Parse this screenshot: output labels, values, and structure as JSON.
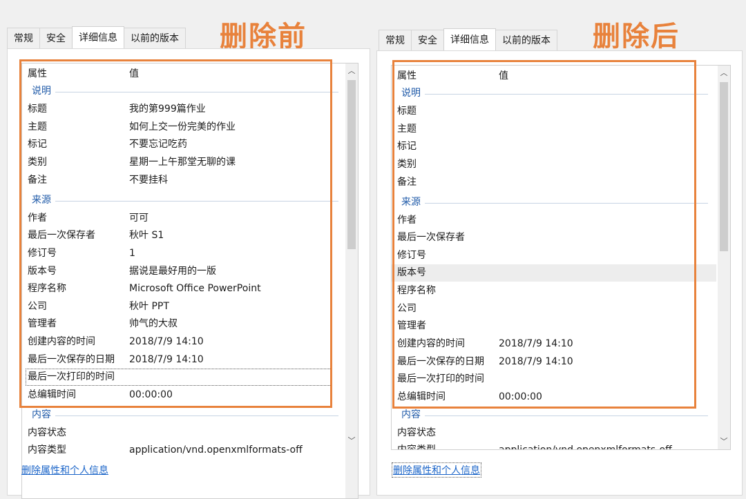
{
  "left": {
    "title": "删除前",
    "tabs": [
      "常规",
      "安全",
      "详细信息",
      "以前的版本"
    ],
    "columns": {
      "property": "属性",
      "value": "值"
    },
    "sections": {
      "desc": "说明",
      "origin": "来源",
      "content": "内容"
    },
    "rows": [
      {
        "k": "标题",
        "v": "我的第999篇作业"
      },
      {
        "k": "主题",
        "v": "如何上交一份完美的作业"
      },
      {
        "k": "标记",
        "v": "不要忘记吃药"
      },
      {
        "k": "类别",
        "v": "星期一上午那堂无聊的课"
      },
      {
        "k": "备注",
        "v": "不要挂科"
      },
      {
        "k": "作者",
        "v": "可可"
      },
      {
        "k": "最后一次保存者",
        "v": "秋叶 S1"
      },
      {
        "k": "修订号",
        "v": "1"
      },
      {
        "k": "版本号",
        "v": "据说是最好用的一版"
      },
      {
        "k": "程序名称",
        "v": "Microsoft Office PowerPoint"
      },
      {
        "k": "公司",
        "v": "秋叶 PPT"
      },
      {
        "k": "管理者",
        "v": "帅气的大叔"
      },
      {
        "k": "创建内容的时间",
        "v": "2018/7/9 14:10"
      },
      {
        "k": "最后一次保存的日期",
        "v": "2018/7/9 14:10"
      },
      {
        "k": "最后一次打印的时间",
        "v": ""
      },
      {
        "k": "总编辑时间",
        "v": "00:00:00"
      },
      {
        "k": "内容状态",
        "v": ""
      },
      {
        "k": "内容类型",
        "v": "application/vnd.openxmlformats-off"
      }
    ],
    "link": "删除属性和个人信息"
  },
  "right": {
    "title": "删除后",
    "tabs": [
      "常规",
      "安全",
      "详细信息",
      "以前的版本"
    ],
    "columns": {
      "property": "属性",
      "value": "值"
    },
    "sections": {
      "desc": "说明",
      "origin": "来源",
      "content": "内容"
    },
    "rows": [
      {
        "k": "标题",
        "v": ""
      },
      {
        "k": "主题",
        "v": ""
      },
      {
        "k": "标记",
        "v": ""
      },
      {
        "k": "类别",
        "v": ""
      },
      {
        "k": "备注",
        "v": ""
      },
      {
        "k": "作者",
        "v": ""
      },
      {
        "k": "最后一次保存者",
        "v": ""
      },
      {
        "k": "修订号",
        "v": ""
      },
      {
        "k": "版本号",
        "v": ""
      },
      {
        "k": "程序名称",
        "v": ""
      },
      {
        "k": "公司",
        "v": ""
      },
      {
        "k": "管理者",
        "v": ""
      },
      {
        "k": "创建内容的时间",
        "v": "2018/7/9 14:10"
      },
      {
        "k": "最后一次保存的日期",
        "v": "2018/7/9 14:10"
      },
      {
        "k": "最后一次打印的时间",
        "v": ""
      },
      {
        "k": "总编辑时间",
        "v": "00:00:00"
      },
      {
        "k": "内容状态",
        "v": ""
      },
      {
        "k": "内容类型",
        "v": "application/vnd.openxmlformats-off"
      }
    ],
    "link": "删除属性和个人信息"
  },
  "colors": {
    "accent": "#e8823c",
    "section": "#1f5aa8",
    "link": "#1a64c8"
  },
  "icons": {
    "scroll_up": "chevron-up-icon",
    "scroll_down": "chevron-down-icon"
  }
}
